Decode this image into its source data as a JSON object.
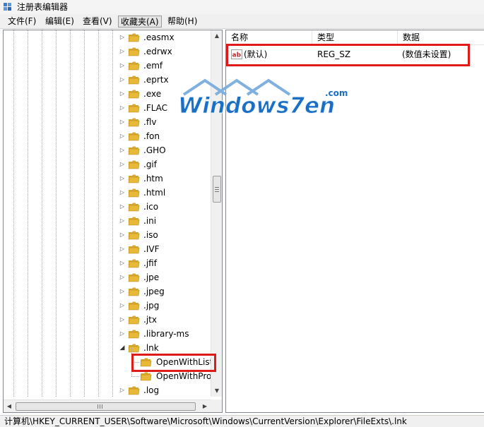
{
  "window": {
    "title": "注册表编辑器"
  },
  "menu": [
    {
      "label": "文件(F)",
      "active": false
    },
    {
      "label": "编辑(E)",
      "active": false
    },
    {
      "label": "查看(V)",
      "active": false
    },
    {
      "label": "收藏夹(A)",
      "active": true
    },
    {
      "label": "帮助(H)",
      "active": false
    }
  ],
  "tree": {
    "items": [
      {
        "label": ".easmx",
        "expander": "collapsed"
      },
      {
        "label": ".edrwx",
        "expander": "collapsed"
      },
      {
        "label": ".emf",
        "expander": "collapsed"
      },
      {
        "label": ".eprtx",
        "expander": "collapsed"
      },
      {
        "label": ".exe",
        "expander": "collapsed"
      },
      {
        "label": ".FLAC",
        "expander": "collapsed"
      },
      {
        "label": ".flv",
        "expander": "collapsed"
      },
      {
        "label": ".fon",
        "expander": "collapsed"
      },
      {
        "label": ".GHO",
        "expander": "collapsed"
      },
      {
        "label": ".gif",
        "expander": "collapsed"
      },
      {
        "label": ".htm",
        "expander": "collapsed"
      },
      {
        "label": ".html",
        "expander": "collapsed"
      },
      {
        "label": ".ico",
        "expander": "collapsed"
      },
      {
        "label": ".ini",
        "expander": "collapsed"
      },
      {
        "label": ".iso",
        "expander": "collapsed"
      },
      {
        "label": ".IVF",
        "expander": "collapsed"
      },
      {
        "label": ".jfif",
        "expander": "collapsed"
      },
      {
        "label": ".jpe",
        "expander": "collapsed"
      },
      {
        "label": ".jpeg",
        "expander": "collapsed"
      },
      {
        "label": ".jpg",
        "expander": "collapsed"
      },
      {
        "label": ".jtx",
        "expander": "collapsed"
      },
      {
        "label": ".library-ms",
        "expander": "collapsed"
      },
      {
        "label": ".lnk",
        "expander": "expanded"
      },
      {
        "label": "OpenWithList",
        "expander": "none",
        "child": true,
        "highlighted": true
      },
      {
        "label": "OpenWithProgids",
        "expander": "none",
        "child": true
      },
      {
        "label": ".log",
        "expander": "collapsed"
      }
    ]
  },
  "list": {
    "columns": [
      "名称",
      "类型",
      "数据"
    ],
    "rows": [
      {
        "name": "(默认)",
        "type": "REG_SZ",
        "data": "(数值未设置)",
        "icon": "string-value-icon"
      }
    ]
  },
  "watermark": {
    "text": "Windows7en",
    "suffix": ".com"
  },
  "status": {
    "path": "计算机\\HKEY_CURRENT_USER\\Software\\Microsoft\\Windows\\CurrentVersion\\Explorer\\FileExts\\.lnk"
  },
  "colors": {
    "highlight_box": "#e01919",
    "folder": "#e8b838",
    "watermark": "#1a6fc4"
  }
}
